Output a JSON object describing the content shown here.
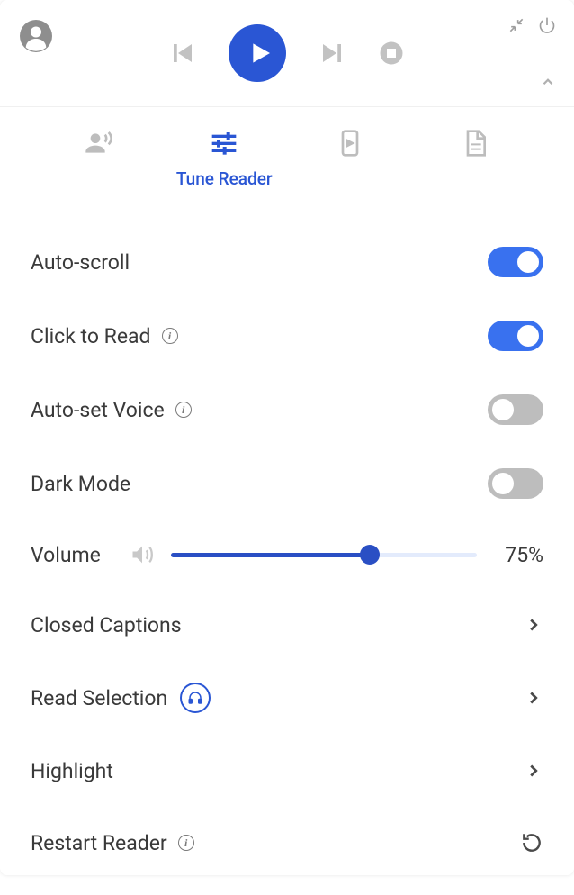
{
  "tabs": {
    "active_label": "Tune Reader"
  },
  "settings": {
    "auto_scroll": {
      "label": "Auto-scroll",
      "on": true
    },
    "click_to_read": {
      "label": "Click to Read",
      "on": true
    },
    "auto_set_voice": {
      "label": "Auto-set Voice",
      "on": false
    },
    "dark_mode": {
      "label": "Dark Mode",
      "on": false
    },
    "volume": {
      "label": "Volume",
      "value_text": "75%",
      "percent": 75
    },
    "closed_captions": {
      "label": "Closed Captions"
    },
    "read_selection": {
      "label": "Read Selection"
    },
    "highlight": {
      "label": "Highlight"
    },
    "restart_reader": {
      "label": "Restart Reader"
    }
  }
}
